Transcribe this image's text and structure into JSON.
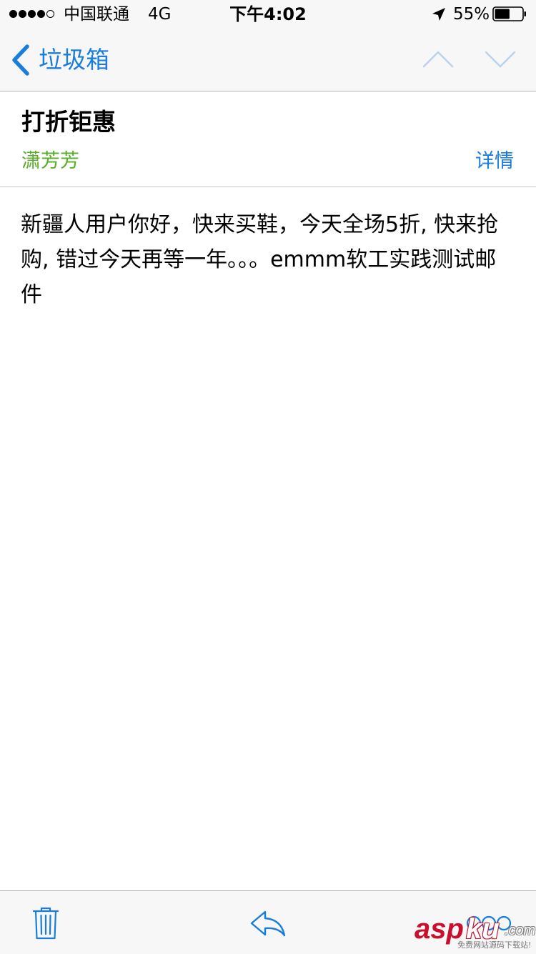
{
  "status_bar": {
    "signal_dots": [
      true,
      true,
      true,
      true,
      false
    ],
    "carrier": "中国联通",
    "network": "4G",
    "time": "下午4:02",
    "battery_percent": "55%",
    "battery_level": 0.55,
    "location_icon": "location-arrow-icon",
    "battery_icon": "battery-icon"
  },
  "nav": {
    "back_label": "垃圾箱",
    "back_icon": "chevron-left-icon",
    "prev_icon": "chevron-up-icon",
    "next_icon": "chevron-down-icon"
  },
  "message": {
    "subject": "打折钜惠",
    "sender": "潇芳芳",
    "details_label": "详情",
    "body": "新疆人用户你好，快来买鞋，今天全场5折, 快来抢购, 错过今天再等一年。。。emmm软工实践测试邮件"
  },
  "toolbar": {
    "trash_icon": "trash-icon",
    "reply_icon": "reply-icon",
    "compose_icon": "compose-icon"
  },
  "watermark": {
    "brand_a": "asp",
    "brand_b": "ku",
    "brand_c": ".com",
    "tagline": "免费网站源码下载站!"
  },
  "colors": {
    "accent": "#1a7ddc",
    "sender": "#58ad29",
    "bar_background": "#f7f7f7",
    "watermark_red": "#c8102e"
  }
}
